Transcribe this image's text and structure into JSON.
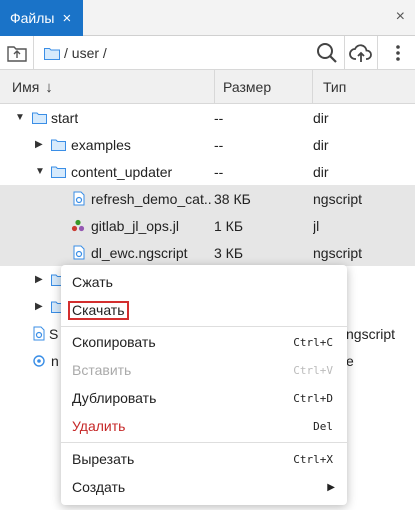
{
  "tab": {
    "title": "Файлы",
    "close_glyph": "×"
  },
  "panel": {
    "close_glyph": "×"
  },
  "toolbar": {
    "path": "/ user /"
  },
  "columns": {
    "name": "Имя",
    "sort_arrow": "↓",
    "size": "Размер",
    "type": "Тип"
  },
  "rows": [
    {
      "name": "start",
      "size": "--",
      "type": "dir",
      "icon": "folder-icon",
      "arrow": "▼"
    },
    {
      "name": "examples",
      "size": "--",
      "type": "dir",
      "icon": "folder-icon",
      "arrow": "▶"
    },
    {
      "name": "content_updater",
      "size": "--",
      "type": "dir",
      "icon": "folder-icon",
      "arrow": "▼"
    },
    {
      "name": "refresh_demo_cat...",
      "size": "38 КБ",
      "type": "ngscript",
      "icon": "ngscript-file-icon",
      "selected": true
    },
    {
      "name": "gitlab_jl_ops.jl",
      "size": "1 КБ",
      "type": "jl",
      "icon": "julia-file-icon",
      "selected": true
    },
    {
      "name": "dl_ewc.ngscript",
      "size": "3 КБ",
      "type": "ngscript",
      "icon": "ngscript-file-icon",
      "selected": true
    },
    {
      "name": "",
      "size": "",
      "type": "",
      "icon": "folder-icon",
      "arrow": "▶"
    },
    {
      "name": "",
      "size": "",
      "type": "",
      "icon": "folder-icon",
      "arrow": "▶"
    },
    {
      "name": "S",
      "size": "",
      "type": "ngscript",
      "icon": "ngscript-file-icon"
    },
    {
      "name": "n",
      "size": "",
      "type": "e",
      "icon": "gear-file-icon"
    }
  ],
  "context_menu": {
    "compress": "Сжать",
    "download": "Скачать",
    "copy": "Скопировать",
    "copy_sc": "Ctrl+C",
    "paste": "Вставить",
    "paste_sc": "Ctrl+V",
    "duplicate": "Дублировать",
    "duplicate_sc": "Ctrl+D",
    "delete": "Удалить",
    "delete_sc": "Del",
    "cut": "Вырезать",
    "cut_sc": "Ctrl+X",
    "create": "Создать",
    "create_arrow": "▶"
  },
  "colors": {
    "accent": "#1a73c8",
    "selection": "#e6e6e6",
    "danger": "#c62828",
    "highlight_box": "#d32f2f",
    "folder": "#3a8ee6"
  }
}
